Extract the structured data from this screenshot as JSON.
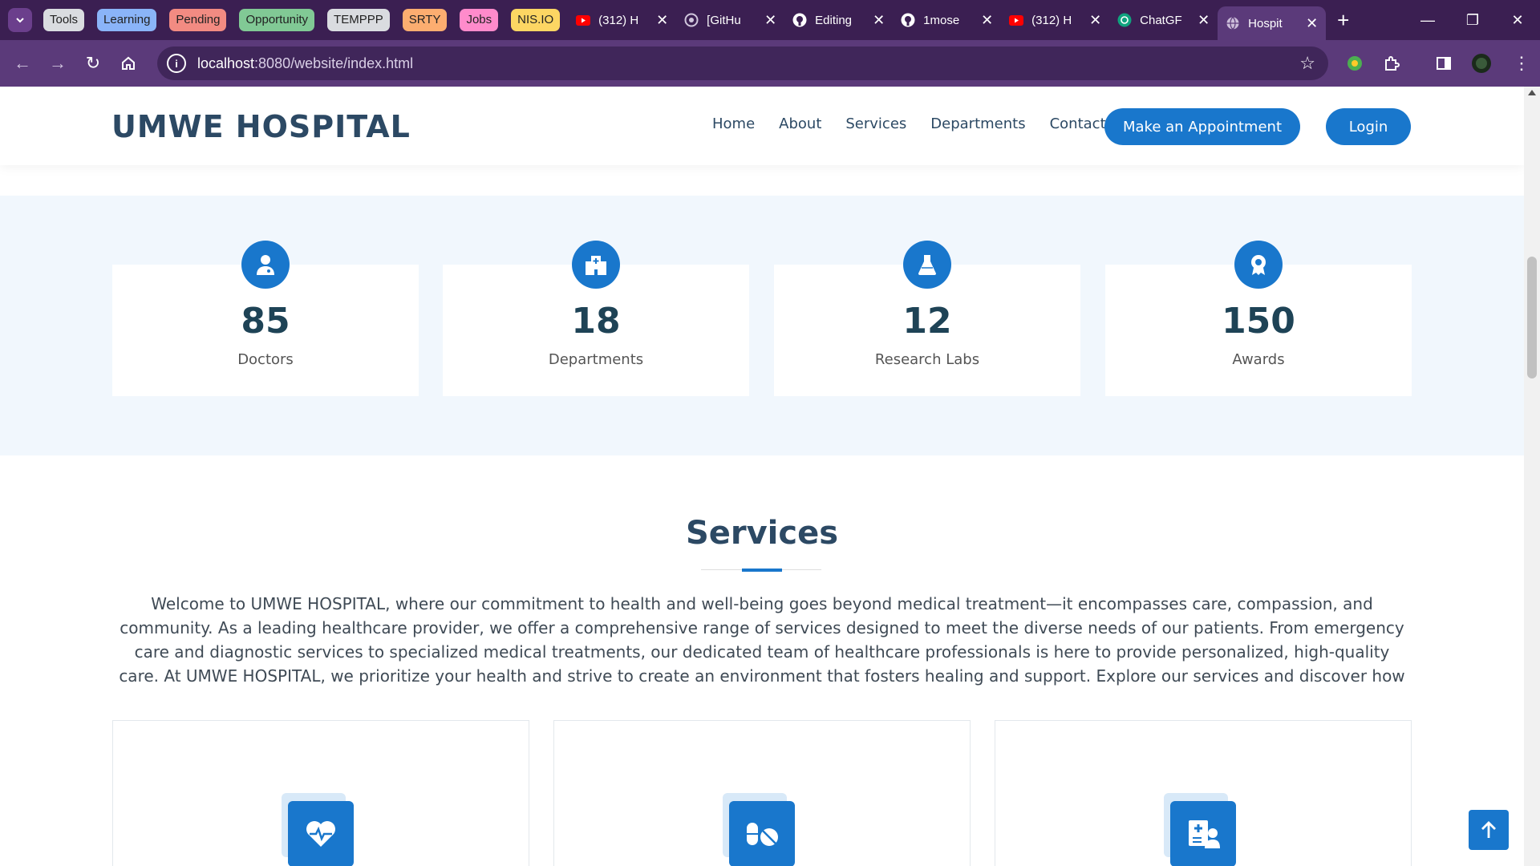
{
  "browser": {
    "tab_groups": [
      {
        "label": "Tools",
        "color": "#dadce0"
      },
      {
        "label": "Learning",
        "color": "#8ab4f8"
      },
      {
        "label": "Pending",
        "color": "#f28b82"
      },
      {
        "label": "Opportunity",
        "color": "#81c995"
      },
      {
        "label": "TEMPPP",
        "color": "#dadce0"
      },
      {
        "label": "SRTY",
        "color": "#fcad70"
      },
      {
        "label": "Jobs",
        "color": "#ff8bcb"
      },
      {
        "label": "NIS.IO",
        "color": "#fdd663"
      }
    ],
    "tabs": [
      {
        "title": "(312) H",
        "icon": "youtube-icon"
      },
      {
        "title": "[GitHu",
        "icon": "site-icon"
      },
      {
        "title": "Editing",
        "icon": "github-icon"
      },
      {
        "title": "1mose",
        "icon": "github-icon"
      },
      {
        "title": "(312) H",
        "icon": "youtube-icon"
      },
      {
        "title": "ChatGF",
        "icon": "chatgpt-icon"
      },
      {
        "title": "Hospit",
        "icon": "globe-icon",
        "active": true
      }
    ],
    "url_host": "localhost",
    "url_path": ":8080/website/index.html"
  },
  "site": {
    "logo": "UMWE HOSPITAL",
    "nav": [
      "Home",
      "About",
      "Services",
      "Departments",
      "Contact"
    ],
    "appointment_button": "Make an Appointment",
    "login_button": "Login",
    "accent_color": "#1977cc",
    "stats": [
      {
        "value": "85",
        "label": "Doctors",
        "icon": "user-doctor-icon"
      },
      {
        "value": "18",
        "label": "Departments",
        "icon": "hospital-icon"
      },
      {
        "value": "12",
        "label": "Research Labs",
        "icon": "flask-icon"
      },
      {
        "value": "150",
        "label": "Awards",
        "icon": "award-icon"
      }
    ],
    "services": {
      "title": "Services",
      "description": "Welcome to UMWE HOSPITAL, where our commitment to health and well-being goes beyond medical treatment—it encompasses care, compassion, and community. As a leading healthcare provider, we offer a comprehensive range of services designed to meet the diverse needs of our patients. From emergency care and diagnostic services to specialized medical treatments, our dedicated team of healthcare professionals is here to provide personalized, high-quality care. At UMWE HOSPITAL, we prioritize your health and strive to create an environment that fosters healing and support. Explore our services and discover how we can be your partner in achieving optimal health and",
      "cards": [
        {
          "icon": "heartbeat-icon"
        },
        {
          "icon": "pills-icon"
        },
        {
          "icon": "hospital-user-icon"
        }
      ]
    }
  }
}
